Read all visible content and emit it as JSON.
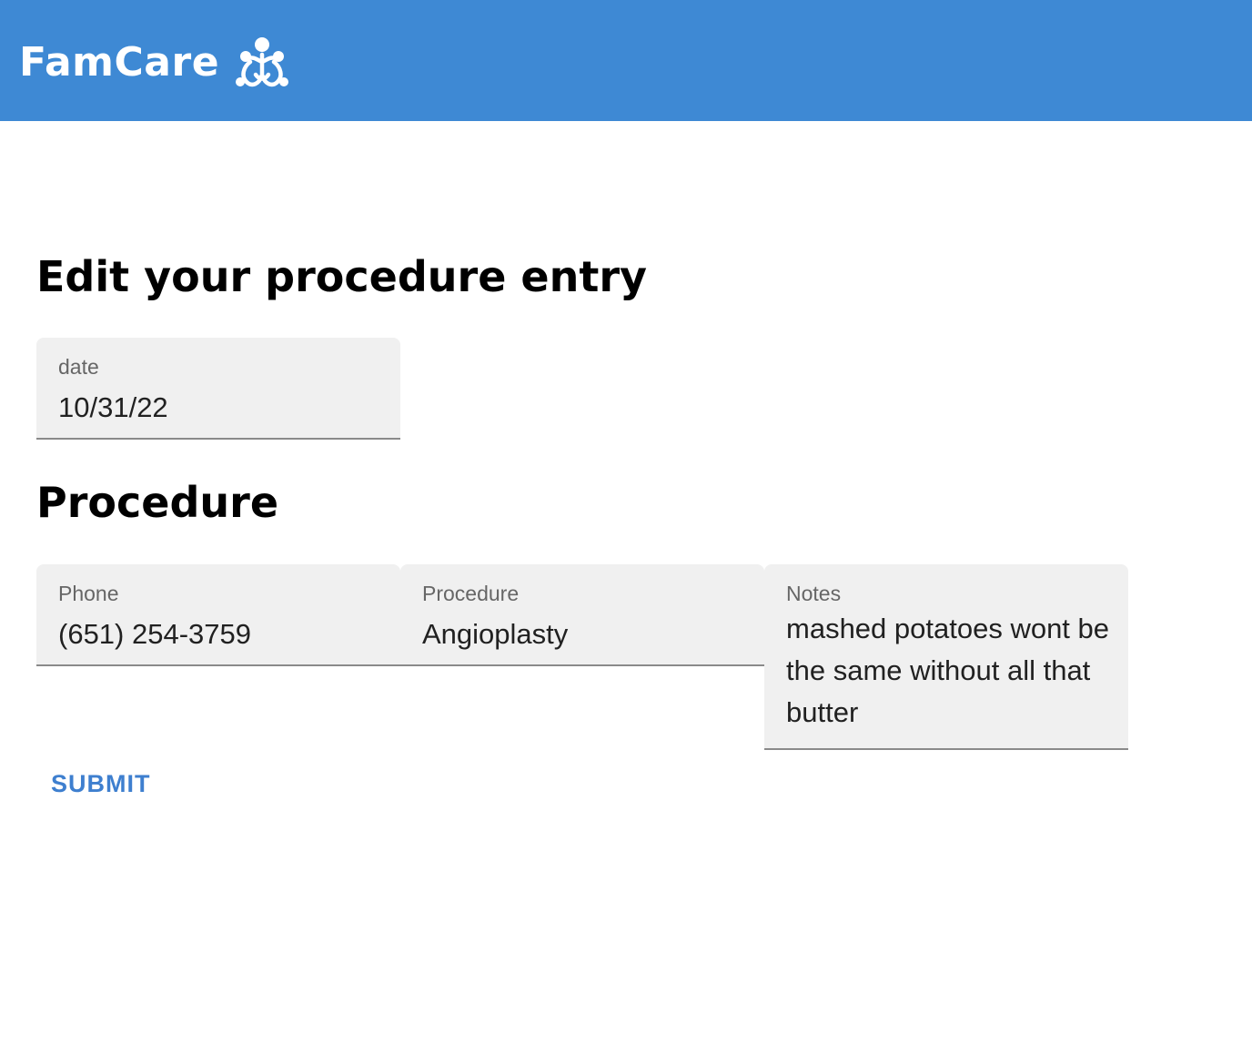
{
  "header": {
    "brand": "FamCare",
    "logo_icon": "family-care-icon",
    "background_color": "#3e89d4"
  },
  "page_title": "Edit your procedure entry",
  "date_field": {
    "label": "date",
    "value": "10/31/22"
  },
  "section_title": "Procedure",
  "procedure_fields": {
    "phone": {
      "label": "Phone",
      "value": "(651) 254-3759"
    },
    "procedure": {
      "label": "Procedure",
      "value": "Angioplasty"
    },
    "notes": {
      "label": "Notes",
      "value": "mashed potatoes wont be the same without all that butter"
    }
  },
  "submit_label": "SUBMIT",
  "accent_color": "#3e7fcf"
}
